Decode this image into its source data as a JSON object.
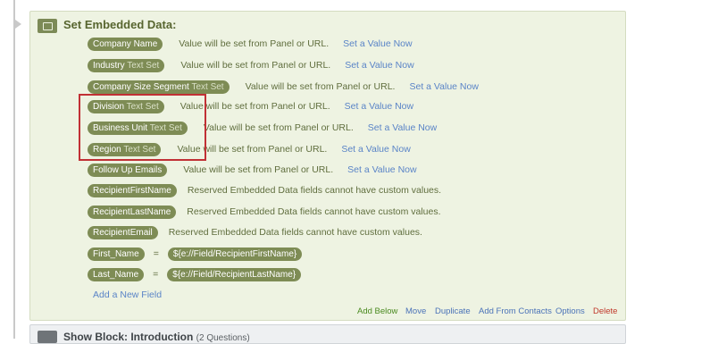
{
  "block": {
    "title": "Set Embedded Data:"
  },
  "fields": [
    {
      "name": "Company Name",
      "type": "",
      "desc": "Value will be set from Panel or URL.",
      "link": "Set a Value Now"
    },
    {
      "name": "Industry",
      "type": "Text Set",
      "desc": "Value will be set from Panel or URL.",
      "link": "Set a Value Now"
    },
    {
      "name": "Company Size Segment",
      "type": "Text Set",
      "desc": "Value will be set from Panel or URL.",
      "link": "Set a Value Now"
    },
    {
      "name": "Division",
      "type": "Text Set",
      "desc": "Value will be set from Panel or URL.",
      "link": "Set a Value Now"
    },
    {
      "name": "Business Unit",
      "type": "Text Set",
      "desc": "Value will be set from Panel or URL.",
      "link": "Set a Value Now"
    },
    {
      "name": "Region",
      "type": "Text Set",
      "desc": "Value will be set from Panel or URL.",
      "link": "Set a Value Now"
    },
    {
      "name": "Follow Up Emails",
      "type": "",
      "desc": "Value will be set from Panel or URL.",
      "link": "Set a Value Now"
    },
    {
      "name": "RecipientFirstName",
      "type": "",
      "desc": "Reserved Embedded Data fields cannot have custom values.",
      "link": ""
    },
    {
      "name": "RecipientLastName",
      "type": "",
      "desc": "Reserved Embedded Data fields cannot have custom values.",
      "link": ""
    },
    {
      "name": "RecipientEmail",
      "type": "",
      "desc": "Reserved Embedded Data fields cannot have custom values.",
      "link": ""
    }
  ],
  "assignments": [
    {
      "name": "First_Name",
      "equals": "=",
      "value": "${e://Field/RecipientFirstName}"
    },
    {
      "name": "Last_Name",
      "equals": "=",
      "value": "${e://Field/RecipientLastName}"
    }
  ],
  "add_field_label": "Add a New Field",
  "footer": {
    "add_below": "Add Below",
    "move": "Move",
    "duplicate": "Duplicate",
    "add_from_contacts": "Add From Contacts",
    "options": "Options",
    "delete": "Delete"
  },
  "next_block": {
    "title": "Show Block: Introduction",
    "count": "(2 Questions)"
  },
  "colors": {
    "pill": "#7e8c55",
    "link": "#5a84c7",
    "highlight": "#c13035",
    "delete": "#c0392b",
    "add_below": "#4a8a1f"
  }
}
